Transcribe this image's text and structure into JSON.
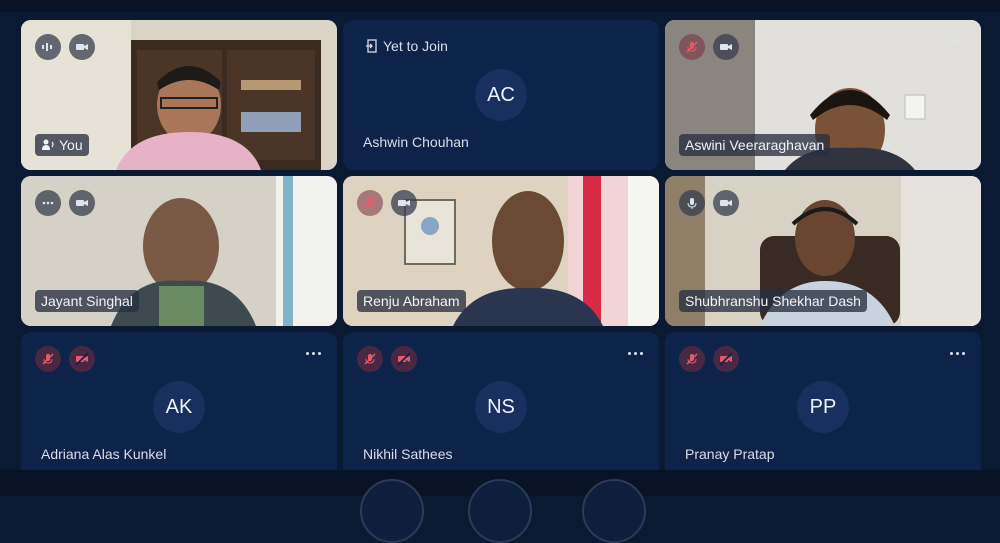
{
  "tiles": [
    {
      "name": "You",
      "type": "video"
    },
    {
      "name": "Ashwin Chouhan",
      "type": "avatar",
      "initials": "AC",
      "status": "Yet to Join"
    },
    {
      "name": "Aswini Veeraraghavan",
      "type": "video"
    },
    {
      "name": "Jayant Singhal",
      "type": "video"
    },
    {
      "name": "Renju Abraham",
      "type": "video"
    },
    {
      "name": "Shubhranshu Shekhar Dash",
      "type": "video"
    },
    {
      "name": "Adriana Alas Kunkel",
      "type": "avatar",
      "initials": "AK"
    },
    {
      "name": "Nikhil Sathees",
      "type": "avatar",
      "initials": "NS"
    },
    {
      "name": "Pranay Pratap",
      "type": "avatar",
      "initials": "PP"
    }
  ],
  "colors": {
    "background": "#0b1a33",
    "tile_bg": "#0e2349",
    "avatar_bg": "#17305d",
    "muted_red": "#e35a6a"
  },
  "icons": [
    "mic-icon",
    "mic-off-icon",
    "video-camera-icon",
    "video-off-icon",
    "more-icon",
    "people-icon",
    "join-arrow-icon"
  ]
}
